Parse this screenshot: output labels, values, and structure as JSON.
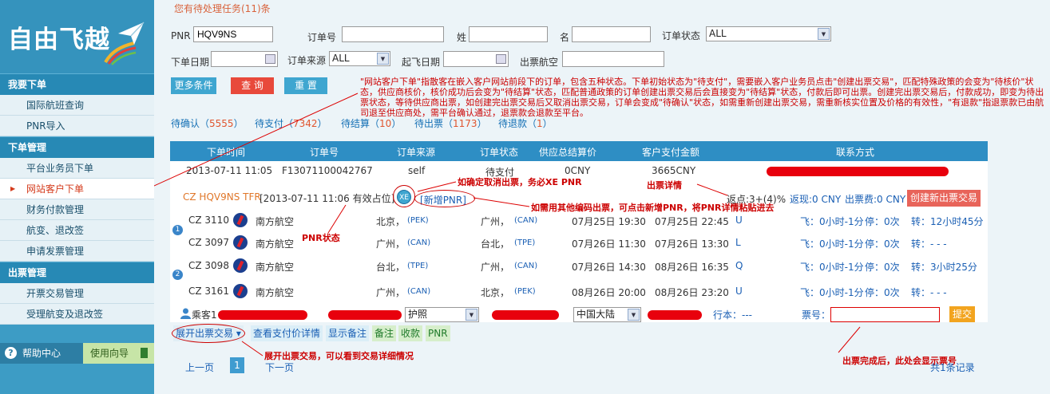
{
  "logo_text": "自由飞越",
  "sidebar": {
    "sections": [
      {
        "title": "我要下单",
        "items": [
          "国际航班查询",
          "PNR导入"
        ]
      },
      {
        "title": "下单管理",
        "items": [
          "平台业务员下单",
          "网站客户下单",
          "财务付款管理",
          "航变、退改签",
          "申请发票管理"
        ]
      },
      {
        "title": "出票管理",
        "items": [
          "开票交易管理",
          "受理航变及退改签"
        ]
      }
    ],
    "active_item": "网站客户下单",
    "help": "帮助中心",
    "guide": "使用向导"
  },
  "pending_notice": "您有待处理任务(11)条",
  "search": {
    "pnr_label": "PNR",
    "pnr_value": "HQV9NS",
    "order_no_label": "订单号",
    "surname_label": "姓",
    "given_label": "名",
    "status_label": "订单状态",
    "status_value": "ALL",
    "order_date_label": "下单日期",
    "source_label": "订单来源",
    "source_value": "ALL",
    "depart_date_label": "起飞日期",
    "ticket_route_label": "出票航空",
    "more_btn": "更多条件",
    "query_btn": "查 询",
    "reset_btn": "重 置"
  },
  "tabs": [
    {
      "label": "待确认",
      "count": "5555"
    },
    {
      "label": "待支付",
      "count": "7342"
    },
    {
      "label": "待结算",
      "count": "10"
    },
    {
      "label": "待出票",
      "count": "1173"
    },
    {
      "label": "待退款",
      "count": "1"
    }
  ],
  "grid_headers": [
    "下单时间",
    "订单号",
    "订单来源",
    "订单状态",
    "供应总结算价",
    "客户支付金额",
    "联系方式"
  ],
  "order": {
    "time": "2013-07-11 11:05",
    "number": "F13071100042767",
    "source": "self",
    "status": "待支付",
    "supply_price": "0CNY",
    "customer_pay": "3665CNY"
  },
  "pnr_line": {
    "pnr": "CZ HQV9NS TFR",
    "info": "[2013-07-11 11:06 有效占位]",
    "xe": "XE",
    "new_pnr": "新增PNR",
    "agent_fee": "返点:3+(4)%",
    "rebate": "返现:0 CNY",
    "ticket_fee": "出票费:0 CNY",
    "create_btn": "创建新出票交易"
  },
  "flights": [
    {
      "group": "1",
      "flight": "CZ 3110",
      "airline": "南方航空",
      "from_city": "北京，",
      "from_code": "(PEK)",
      "to_city": "广州，",
      "to_code": "(CAN)",
      "dep": "07月25日 19:30",
      "arr": "07月25日 22:45",
      "cabin": "U",
      "fly": "飞：0小时-1分",
      "stop": "停：0次",
      "transfer": "转：12小时45分"
    },
    {
      "group": "",
      "flight": "CZ 3097",
      "airline": "南方航空",
      "from_city": "广州，",
      "from_code": "(CAN)",
      "to_city": "台北，",
      "to_code": "(TPE)",
      "dep": "07月26日 11:30",
      "arr": "07月26日 13:30",
      "cabin": "L",
      "fly": "飞：0小时-1分",
      "stop": "停：0次",
      "transfer": "转：- - -"
    },
    {
      "group": "2",
      "flight": "CZ 3098",
      "airline": "南方航空",
      "from_city": "台北，",
      "from_code": "(TPE)",
      "to_city": "广州，",
      "to_code": "(CAN)",
      "dep": "07月26日 14:30",
      "arr": "08月26日 16:35",
      "cabin": "Q",
      "fly": "飞：0小时-1分",
      "stop": "停：0次",
      "transfer": "转：3小时25分"
    },
    {
      "group": "",
      "flight": "CZ 3161",
      "airline": "南方航空",
      "from_city": "广州，",
      "from_code": "(CAN)",
      "to_city": "北京，",
      "to_code": "(PEK)",
      "dep": "08月26日 20:00",
      "arr": "08月26日 23:20",
      "cabin": "U",
      "fly": "飞：0小时-1分",
      "stop": "停：0次",
      "transfer": "转：- - -"
    }
  ],
  "passenger": {
    "label": "乘客1",
    "doc_type": "护照",
    "country": "中国大陆",
    "itinerary": "行本：---",
    "ticket_label": "票号：",
    "submit": "提交"
  },
  "actions": [
    "展开出票交易",
    "查看支付价详情",
    "显示备注",
    "备注",
    "收款",
    "PNR"
  ],
  "pager": {
    "prev": "上一页",
    "page": "1",
    "next": "下一页",
    "total": "共1条记录"
  },
  "annotations": {
    "main": "\"网站客户下单\"指散客在嵌入客户网站前段下的订单，包含五种状态。下单初始状态为\"待支付\"，需要嵌入客户业务员点击\"创建出票交易\"，匹配特殊政策的会变为\"待核价\"状态，供应商核价，核价成功后会变为\"待结算\"状态，匹配普通政策的订单创建出票交易后会直接变为\"待结算\"状态，付款后即可出票。创建完出票交易后，付款成功，即变为待出票状态，等待供应商出票，如创建完出票交易后又取消出票交易，订单会变成\"待确认\"状态，如需重新创建出票交易，需重新核实位置及价格的有效性，\"有退款\"指退票款已由航司退至供应商处，需平台确认通过，退票款会退款至平台。",
    "xe": "如确定取消出票，务必XE PNR",
    "new_pnr": "如需用其他编码出票，可点击新增PNR，将PNR详情粘贴进去",
    "detail": "出票详情",
    "pnr_status": "PNR状态",
    "expand": "展开出票交易，可以看到交易详细情况",
    "ticket_no": "出票完成后，此处会显示票号"
  },
  "colors": {
    "accent": "#2e8ec4",
    "annotation": "#cc0000",
    "tab_count": "#e0552f"
  }
}
